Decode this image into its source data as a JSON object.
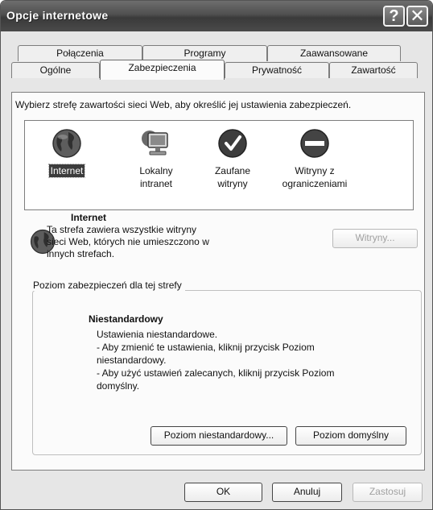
{
  "window": {
    "title": "Opcje internetowe"
  },
  "titlebar": {
    "help_glyph": "?",
    "close_glyph": "✕"
  },
  "tabs": {
    "row1": [
      "Połączenia",
      "Programy",
      "Zaawansowane"
    ],
    "row2": [
      "Ogólne",
      "Zabezpieczenia",
      "Prywatność",
      "Zawartość"
    ],
    "active": "Zabezpieczenia"
  },
  "security": {
    "prompt": "Wybierz strefę zawartości sieci Web, aby określić jej ustawienia zabezpieczeń.",
    "zones": [
      {
        "line1": "Internet",
        "line2": "",
        "icon": "globe-icon"
      },
      {
        "line1": "Lokalny",
        "line2": "intranet",
        "icon": "computer-icon"
      },
      {
        "line1": "Zaufane",
        "line2": "witryny",
        "icon": "checkmark-icon"
      },
      {
        "line1": "Witryny z",
        "line2": "ograniczeniami",
        "icon": "restricted-icon"
      }
    ],
    "selected_zone": "Internet",
    "desc_title": "Internet",
    "desc_lines": [
      "Ta strefa zawiera wszystkie witryny",
      "sieci Web, których nie umieszczono w",
      "innych strefach."
    ],
    "sites_button": "Witryny...",
    "level_group_label": "Poziom zabezpieczeń dla tej strefy",
    "level_title": "Niestandardowy",
    "level_lines": [
      "Ustawienia niestandardowe.",
      "- Aby zmienić te ustawienia, kliknij przycisk Poziom",
      "niestandardowy.",
      "- Aby użyć ustawień zalecanych, kliknij przycisk Poziom",
      "domyślny."
    ],
    "custom_level_button": "Poziom niestandardowy...",
    "default_level_button": "Poziom domyślny"
  },
  "footer": {
    "ok": "OK",
    "cancel": "Anuluj",
    "apply": "Zastosuj"
  }
}
